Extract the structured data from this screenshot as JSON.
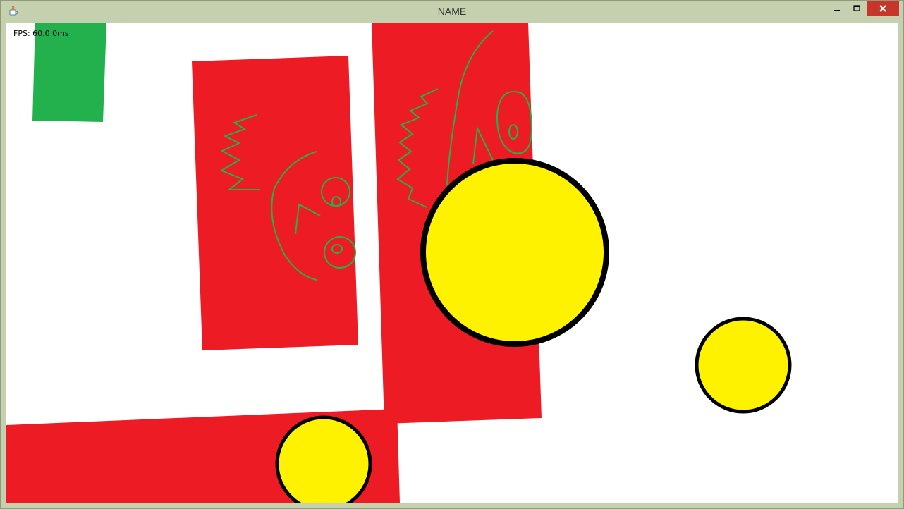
{
  "window": {
    "title": "NAME",
    "icons": [
      "java-cup-icon",
      "minimize-icon",
      "maximize-icon",
      "close-icon"
    ]
  },
  "hud": {
    "fps_text": "FPS: 60.0 0ms"
  },
  "colors": {
    "background": "#ffffff",
    "red_block": "#ed1c24",
    "green_block": "#22b14c",
    "ball_fill": "#fff200",
    "ball_outline": "#000000",
    "doodle": "#22b14c",
    "close_button": "#c7352b"
  },
  "scene": {
    "green_blocks": 1,
    "red_blocks": 3,
    "balls": 3
  }
}
